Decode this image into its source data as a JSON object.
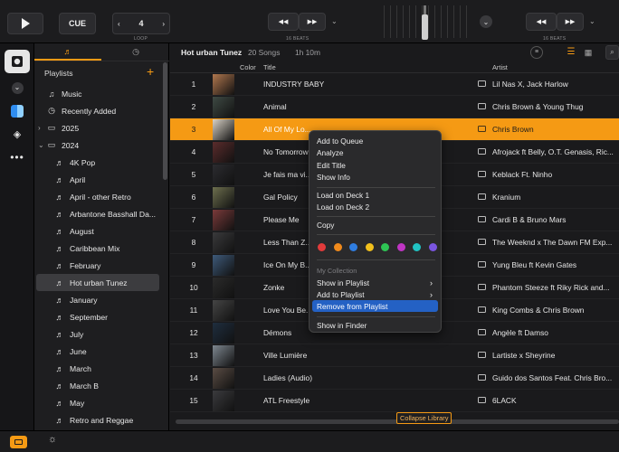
{
  "transport": {
    "cue_label": "CUE",
    "loop_value": "4",
    "loop_label": "LOOP",
    "beats_left": "16 BEATS",
    "beats_right": "16 BEATS"
  },
  "library": {
    "playlist_name": "Hot urban Tunez",
    "song_count": "20 Songs",
    "duration": "1h 10m",
    "col_color": "Color",
    "col_title": "Title",
    "col_artist": "Artist"
  },
  "sidebar": {
    "header": "Playlists",
    "add_icon": "plus-icon",
    "items": [
      {
        "label": "Music",
        "icon": "music-note-icon",
        "indent": 0
      },
      {
        "label": "Recently Added",
        "icon": "clock-icon",
        "indent": 0
      },
      {
        "label": "2025",
        "icon": "folder-icon",
        "indent": 0,
        "chevron": "right"
      },
      {
        "label": "2024",
        "icon": "folder-icon",
        "indent": 0,
        "chevron": "down"
      },
      {
        "label": "4K Pop",
        "icon": "playlist-icon",
        "indent": 1
      },
      {
        "label": "April",
        "icon": "playlist-icon",
        "indent": 1
      },
      {
        "label": "April - other Retro",
        "icon": "playlist-icon",
        "indent": 1
      },
      {
        "label": "Arbantone Basshall Da...",
        "icon": "playlist-icon",
        "indent": 1
      },
      {
        "label": "August",
        "icon": "playlist-icon",
        "indent": 1
      },
      {
        "label": "Caribbean Mix",
        "icon": "playlist-icon",
        "indent": 1
      },
      {
        "label": "February",
        "icon": "playlist-icon",
        "indent": 1
      },
      {
        "label": "Hot urban Tunez",
        "icon": "playlist-icon",
        "indent": 1,
        "selected": true
      },
      {
        "label": "January",
        "icon": "playlist-icon",
        "indent": 1
      },
      {
        "label": "September",
        "icon": "playlist-icon",
        "indent": 1
      },
      {
        "label": "July",
        "icon": "playlist-icon",
        "indent": 1
      },
      {
        "label": "June",
        "icon": "playlist-icon",
        "indent": 1
      },
      {
        "label": "March",
        "icon": "playlist-icon",
        "indent": 1
      },
      {
        "label": "March B",
        "icon": "playlist-icon",
        "indent": 1
      },
      {
        "label": "May",
        "icon": "playlist-icon",
        "indent": 1
      },
      {
        "label": "Retro and Reggae",
        "icon": "playlist-icon",
        "indent": 1
      }
    ]
  },
  "tracks": [
    {
      "num": "1",
      "title": "INDUSTRY BABY",
      "artist": "Lil Nas X, Jack Harlow",
      "art": "#b0774e"
    },
    {
      "num": "2",
      "title": "Animal",
      "artist": "Chris Brown & Young Thug",
      "art": "#3f4a44"
    },
    {
      "num": "3",
      "title": "All Of My Lo...",
      "artist": "Chris Brown",
      "art": "#d9d2c6",
      "selected": true
    },
    {
      "num": "4",
      "title": "No Tomorrow",
      "artist": "Afrojack ft Belly, O.T. Genasis, Ric...",
      "art": "#5b2c2c"
    },
    {
      "num": "5",
      "title": "Je fais ma vi...",
      "artist": "Keblack Ft. Ninho",
      "art": "#2c2c30"
    },
    {
      "num": "6",
      "title": "Gal Policy",
      "artist": "Kranium",
      "art": "#6d6f4e"
    },
    {
      "num": "7",
      "title": "Please Me",
      "artist": "Cardi B & Bruno Mars",
      "art": "#7a3a3a"
    },
    {
      "num": "8",
      "title": "Less Than Z...",
      "artist": "The Weeknd x The Dawn FM Exp...",
      "art": "#3a3a3c"
    },
    {
      "num": "9",
      "title": "Ice On My B...",
      "artist": "Yung Bleu ft Kevin Gates",
      "art": "#3e5a7a"
    },
    {
      "num": "10",
      "title": "Zonke",
      "artist": "Phantom Steeze ft Riky Rick and...",
      "art": "#2b2b2b"
    },
    {
      "num": "11",
      "title": "Love You Be...",
      "artist": "King Combs & Chris Brown",
      "art": "#454545"
    },
    {
      "num": "12",
      "title": "Démons",
      "artist": "Angèle ft Damso",
      "art": "#1f2e3f"
    },
    {
      "num": "13",
      "title": "Ville Lumière",
      "artist": "Lartiste x Sheyrine",
      "art": "#7e8790"
    },
    {
      "num": "14",
      "title": "Ladies (Audio)",
      "artist": "Guido dos Santos Feat. Chris Bro...",
      "art": "#5a4c44"
    },
    {
      "num": "15",
      "title": "ATL Freestyle",
      "artist": "6LACK",
      "art": "#3b3b3e"
    }
  ],
  "context_menu": {
    "items_top": [
      "Add to Queue",
      "Analyze",
      "Edit Title",
      "Show Info"
    ],
    "items_decks": [
      "Load on Deck 1",
      "Load on Deck 2"
    ],
    "copy": "Copy",
    "colors": [
      "#e23b3b",
      "#f08a1c",
      "#2f7de0",
      "#f2c01c",
      "#2ec454",
      "#c035c4",
      "#21c2c2",
      "#7a55e0"
    ],
    "section_label": "My Collection",
    "show_in_playlist": "Show in Playlist",
    "add_to_playlist": "Add to Playlist",
    "remove": "Remove from Playlist",
    "show_in_finder": "Show in Finder"
  },
  "collapse_label": "Collapse Library"
}
